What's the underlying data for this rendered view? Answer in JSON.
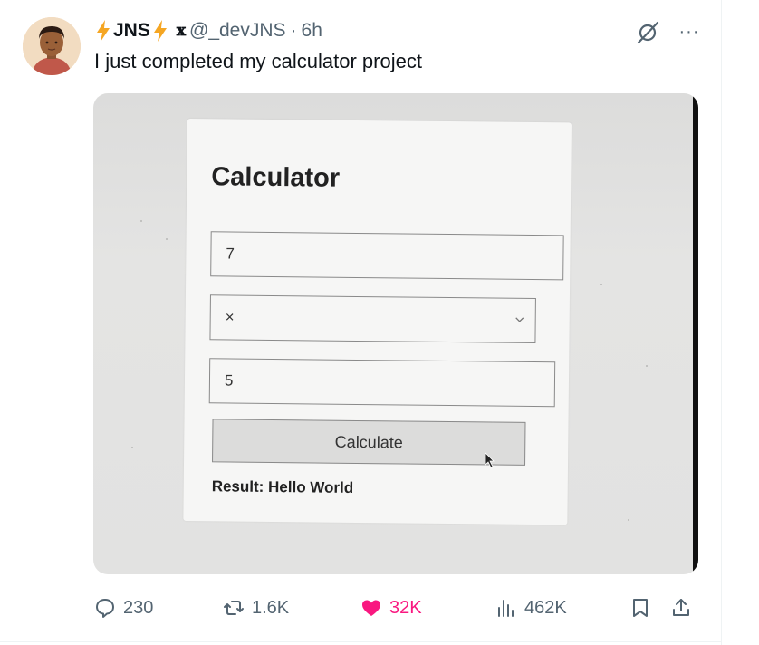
{
  "tweet": {
    "author_name": "JNS",
    "handle": "@_devJNS",
    "separator": "·",
    "time": "6h",
    "x_badge": "𝕩",
    "text": "I just completed my calculator project",
    "more": "···"
  },
  "media": {
    "calculator": {
      "title": "Calculator",
      "first_number": "7",
      "operator": "×",
      "second_number": "5",
      "button_label": "Calculate",
      "result": "Result: Hello World"
    }
  },
  "actions": {
    "replies": "230",
    "reposts": "1.6K",
    "likes": "32K",
    "views": "462K"
  },
  "colors": {
    "bolt": "#f5a623",
    "like": "#f91880",
    "secondary_text": "#536471",
    "primary_text": "#0f1419"
  },
  "icons": [
    "bolt-icon",
    "x-logo-icon",
    "grok-icon",
    "more-icon",
    "reply-icon",
    "repost-icon",
    "like-icon",
    "views-icon",
    "bookmark-icon",
    "share-icon",
    "chevron-down-icon",
    "cursor-icon"
  ]
}
